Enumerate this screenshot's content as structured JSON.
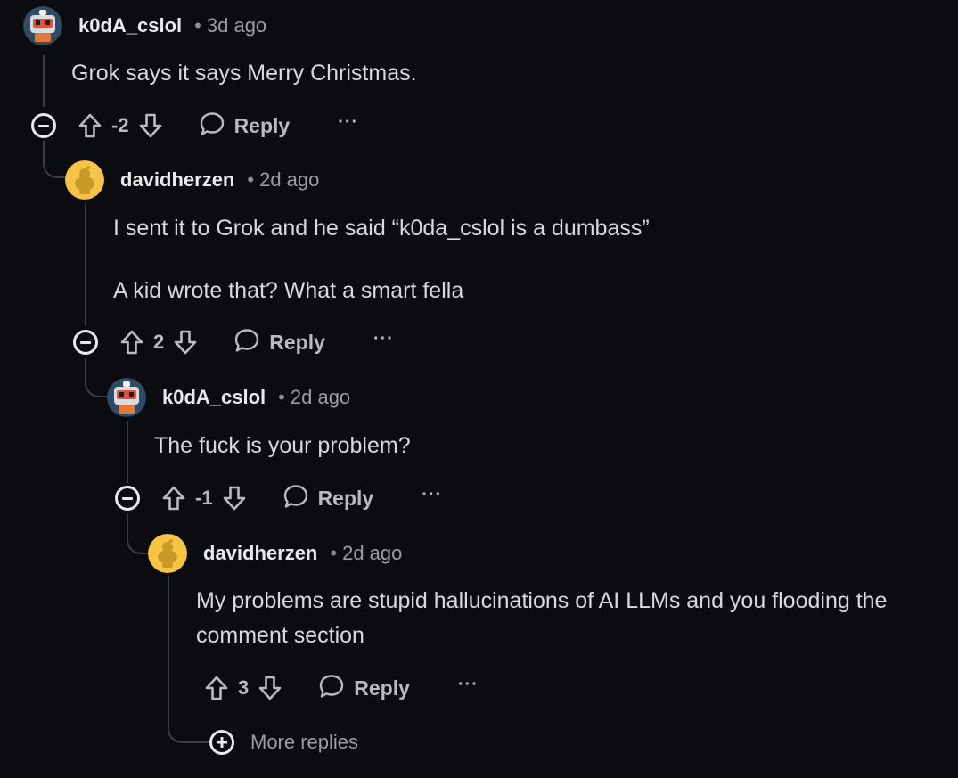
{
  "comments": [
    {
      "username": "k0dA_cslol",
      "separator": "•",
      "time": "3d ago",
      "paragraphs": [
        "Grok says it says Merry Christmas."
      ],
      "score": "-2",
      "reply_label": "Reply",
      "more_label": "···",
      "avatar": "robot-avatar-icon"
    },
    {
      "username": "davidherzen",
      "separator": "•",
      "time": "2d ago",
      "paragraphs": [
        "I sent it to Grok and he said “k0da_cslol is a dumbass”",
        "A kid wrote that? What a smart fella"
      ],
      "score": "2",
      "reply_label": "Reply",
      "more_label": "···",
      "avatar": "snoo-avatar-icon"
    },
    {
      "username": "k0dA_cslol",
      "separator": "•",
      "time": "2d ago",
      "paragraphs": [
        "The fuck is your problem?"
      ],
      "score": "-1",
      "reply_label": "Reply",
      "more_label": "···",
      "avatar": "robot-avatar-icon"
    },
    {
      "username": "davidherzen",
      "separator": "•",
      "time": "2d ago",
      "paragraphs": [
        "My problems are stupid hallucinations of AI LLMs and you flooding the comment section"
      ],
      "score": "3",
      "reply_label": "Reply",
      "more_label": "···",
      "avatar": "snoo-avatar-icon"
    }
  ],
  "more_replies": {
    "label": "More replies"
  },
  "colors": {
    "background": "#0b0c0f",
    "text": "#d7dadc",
    "muted": "#9a9da1",
    "thread_line": "#3a3d42",
    "snoo_yellow": "#f6c445"
  }
}
